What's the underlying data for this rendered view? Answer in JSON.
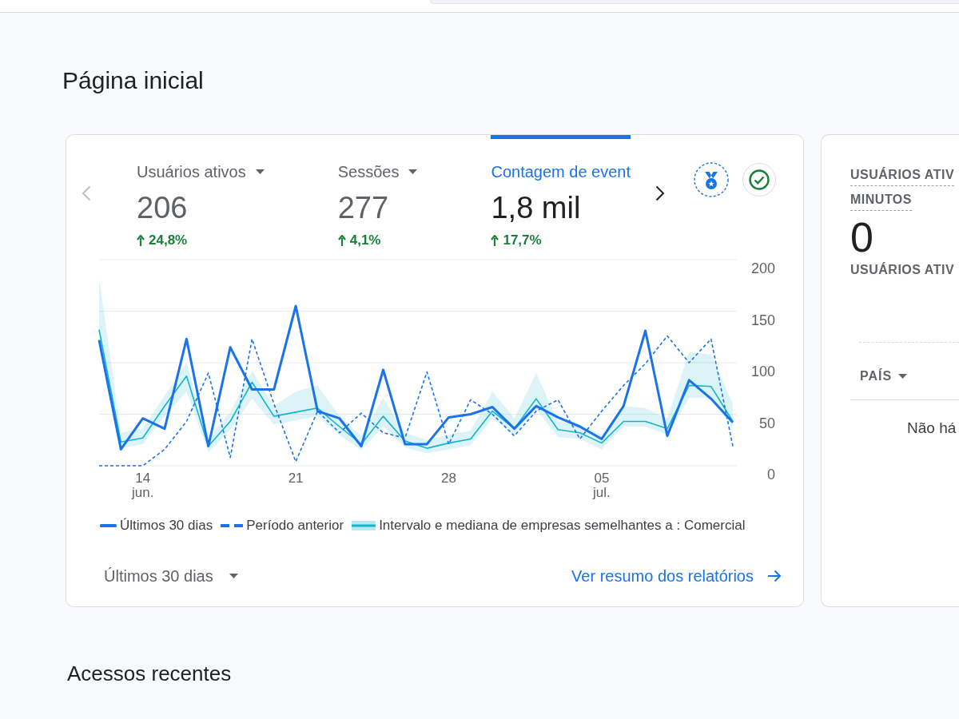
{
  "page_title": "Página inicial",
  "overview": {
    "carousel": {
      "previous": {
        "disabled": true
      },
      "next": {
        "disabled": false
      }
    },
    "metrics": [
      {
        "label": "Usuários ativos",
        "value": "206",
        "change": "24,8%",
        "increase": true,
        "menu": true,
        "selected": false
      },
      {
        "label": "Sessões",
        "value": "277",
        "change": "4,1%",
        "increase": true,
        "menu": true,
        "selected": false
      },
      {
        "label": "Contagem de event",
        "value": "1,8 mil",
        "change": "17,7%",
        "increase": true,
        "menu": false,
        "selected": true
      }
    ],
    "chart_data": {
      "type": "line",
      "grid": true,
      "categories": [
        null,
        null,
        "14 jun.",
        null,
        null,
        null,
        null,
        null,
        null,
        "21",
        null,
        null,
        null,
        null,
        null,
        null,
        "28",
        null,
        null,
        null,
        null,
        null,
        null,
        "05 jul.",
        null,
        null,
        null,
        null,
        null,
        null
      ],
      "ylim": [
        0,
        200
      ],
      "yticks": [
        0,
        50,
        100,
        150,
        200
      ],
      "series": [
        {
          "name": "Últimos 30 dias",
          "line_style": "solid",
          "color": "#1a73e8",
          "values": [
            122,
            16,
            46,
            36,
            123,
            19,
            115,
            74,
            74,
            155,
            53,
            46,
            19,
            93,
            21,
            21,
            47,
            50,
            57,
            36,
            58,
            47,
            38,
            26,
            58,
            131,
            29,
            83,
            65,
            42
          ]
        },
        {
          "name": "Período anterior",
          "line_style": "dashed",
          "color": "#1a73e8",
          "values": [
            0,
            0,
            0,
            16,
            43,
            90,
            8,
            123,
            60,
            4,
            53,
            32,
            51,
            32,
            27,
            91,
            21,
            64,
            50,
            29,
            53,
            64,
            26,
            53,
            78,
            99,
            126,
            100,
            123,
            19
          ]
        },
        {
          "name": "Intervalo e mediana de empresas semelhantes a : Comercial",
          "line_style": "solid",
          "color": "#12b5cb",
          "values": [
            132,
            23,
            27,
            58,
            87,
            19,
            43,
            81,
            48,
            52,
            56,
            38,
            21,
            48,
            24,
            17,
            22,
            26,
            53,
            36,
            65,
            35,
            32,
            22,
            43,
            43,
            36,
            78,
            77,
            43
          ],
          "upper": [
            182,
            32,
            36,
            68,
            100,
            27,
            52,
            92,
            58,
            72,
            78,
            48,
            29,
            66,
            32,
            25,
            30,
            34,
            72,
            46,
            90,
            43,
            40,
            30,
            58,
            56,
            46,
            110,
            108,
            60
          ],
          "lower": [
            118,
            17,
            21,
            48,
            72,
            13,
            35,
            65,
            40,
            44,
            48,
            30,
            15,
            38,
            18,
            12,
            16,
            20,
            46,
            30,
            55,
            28,
            26,
            16,
            38,
            38,
            30,
            66,
            66,
            36
          ]
        }
      ]
    },
    "date_range": "Últimos 30 dias",
    "link": "Ver resumo dos relatórios"
  },
  "realtime": {
    "title_lines": [
      "USUÁRIOS ATIV",
      "MINUTOS"
    ],
    "value": "0",
    "caption": "USUÁRIOS ATIV",
    "table": {
      "column": "PAÍS",
      "empty_message": "Não há"
    }
  },
  "recent_section": {
    "title": "Acessos recentes"
  }
}
